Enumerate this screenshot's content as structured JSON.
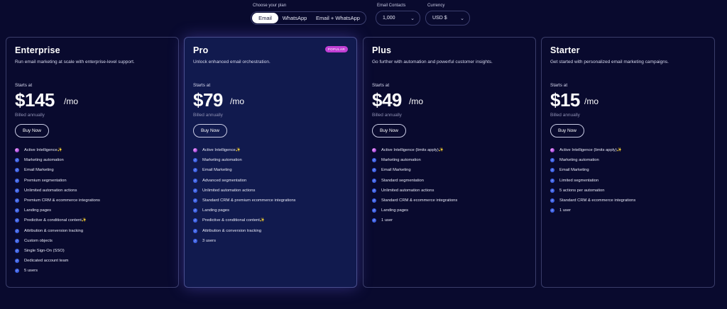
{
  "controls": {
    "plan_label": "Choose your plan",
    "plan_options": [
      "Email",
      "WhatsApp",
      "Email + WhatsApp"
    ],
    "contacts_label": "Email Contacts",
    "contacts_value": "1,000",
    "currency_label": "Currency",
    "currency_value": "USD $"
  },
  "colors": {
    "background": "#090a2e",
    "accent": "#3f63e6",
    "popular": "#c13fd4",
    "pro_card": "#111a4e"
  },
  "plans": [
    {
      "name": "Enterprise",
      "desc": "Run email marketing at scale with enterprise-level support.",
      "starts": "Starts at",
      "price": "$145",
      "per": "/mo",
      "billed": "Billed annually",
      "buy": "Buy Now",
      "features": [
        "Active Intelligence✨",
        "Marketing automation",
        "Email Marketing",
        "Premium segmentation",
        "Unlimited automation actions",
        "Premium CRM & ecommerce integrations",
        "Landing pages",
        "Predictive & conditional content✨",
        "Attribution & conversion tracking",
        "Custom objects",
        "Single Sign-On (SSO)",
        "Dedicated account team",
        "5 users"
      ]
    },
    {
      "name": "Pro",
      "badge": "POPULAR",
      "desc": "Unlock enhanced email orchestration.",
      "starts": "Starts at",
      "price": "$79",
      "per": "/mo",
      "billed": "Billed annually",
      "buy": "Buy Now",
      "features": [
        "Active Intelligence✨",
        "Marketing automation",
        "Email Marketing",
        "Advanced segmentation",
        "Unlimited automation actions",
        "Standard CRM & premium ecommerce integrations",
        "Landing pages",
        "Predictive & conditional content✨",
        "Attribution & conversion tracking",
        "3 users"
      ]
    },
    {
      "name": "Plus",
      "desc": "Go further with automation and powerful customer insights.",
      "starts": "Starts at",
      "price": "$49",
      "per": "/mo",
      "billed": "Billed annually",
      "buy": "Buy Now",
      "features": [
        "Active Intelligence (limits apply)✨",
        "Marketing automation",
        "Email Marketing",
        "Standard segmentation",
        "Unlimited automation actions",
        "Standard CRM & ecommerce integrations",
        "Landing pages",
        "1 user"
      ]
    },
    {
      "name": "Starter",
      "desc": "Get started with personalized email marketing campaigns.",
      "starts": "Starts at",
      "price": "$15",
      "per": "/mo",
      "billed": "Billed annually",
      "buy": "Buy Now",
      "features": [
        "Active Intelligence (limits apply)✨",
        "Marketing automation",
        "Email Marketing",
        "Limited segmentation",
        "5 actions per automation",
        "Standard CRM & ecommerce integrations",
        "1 user"
      ]
    }
  ]
}
